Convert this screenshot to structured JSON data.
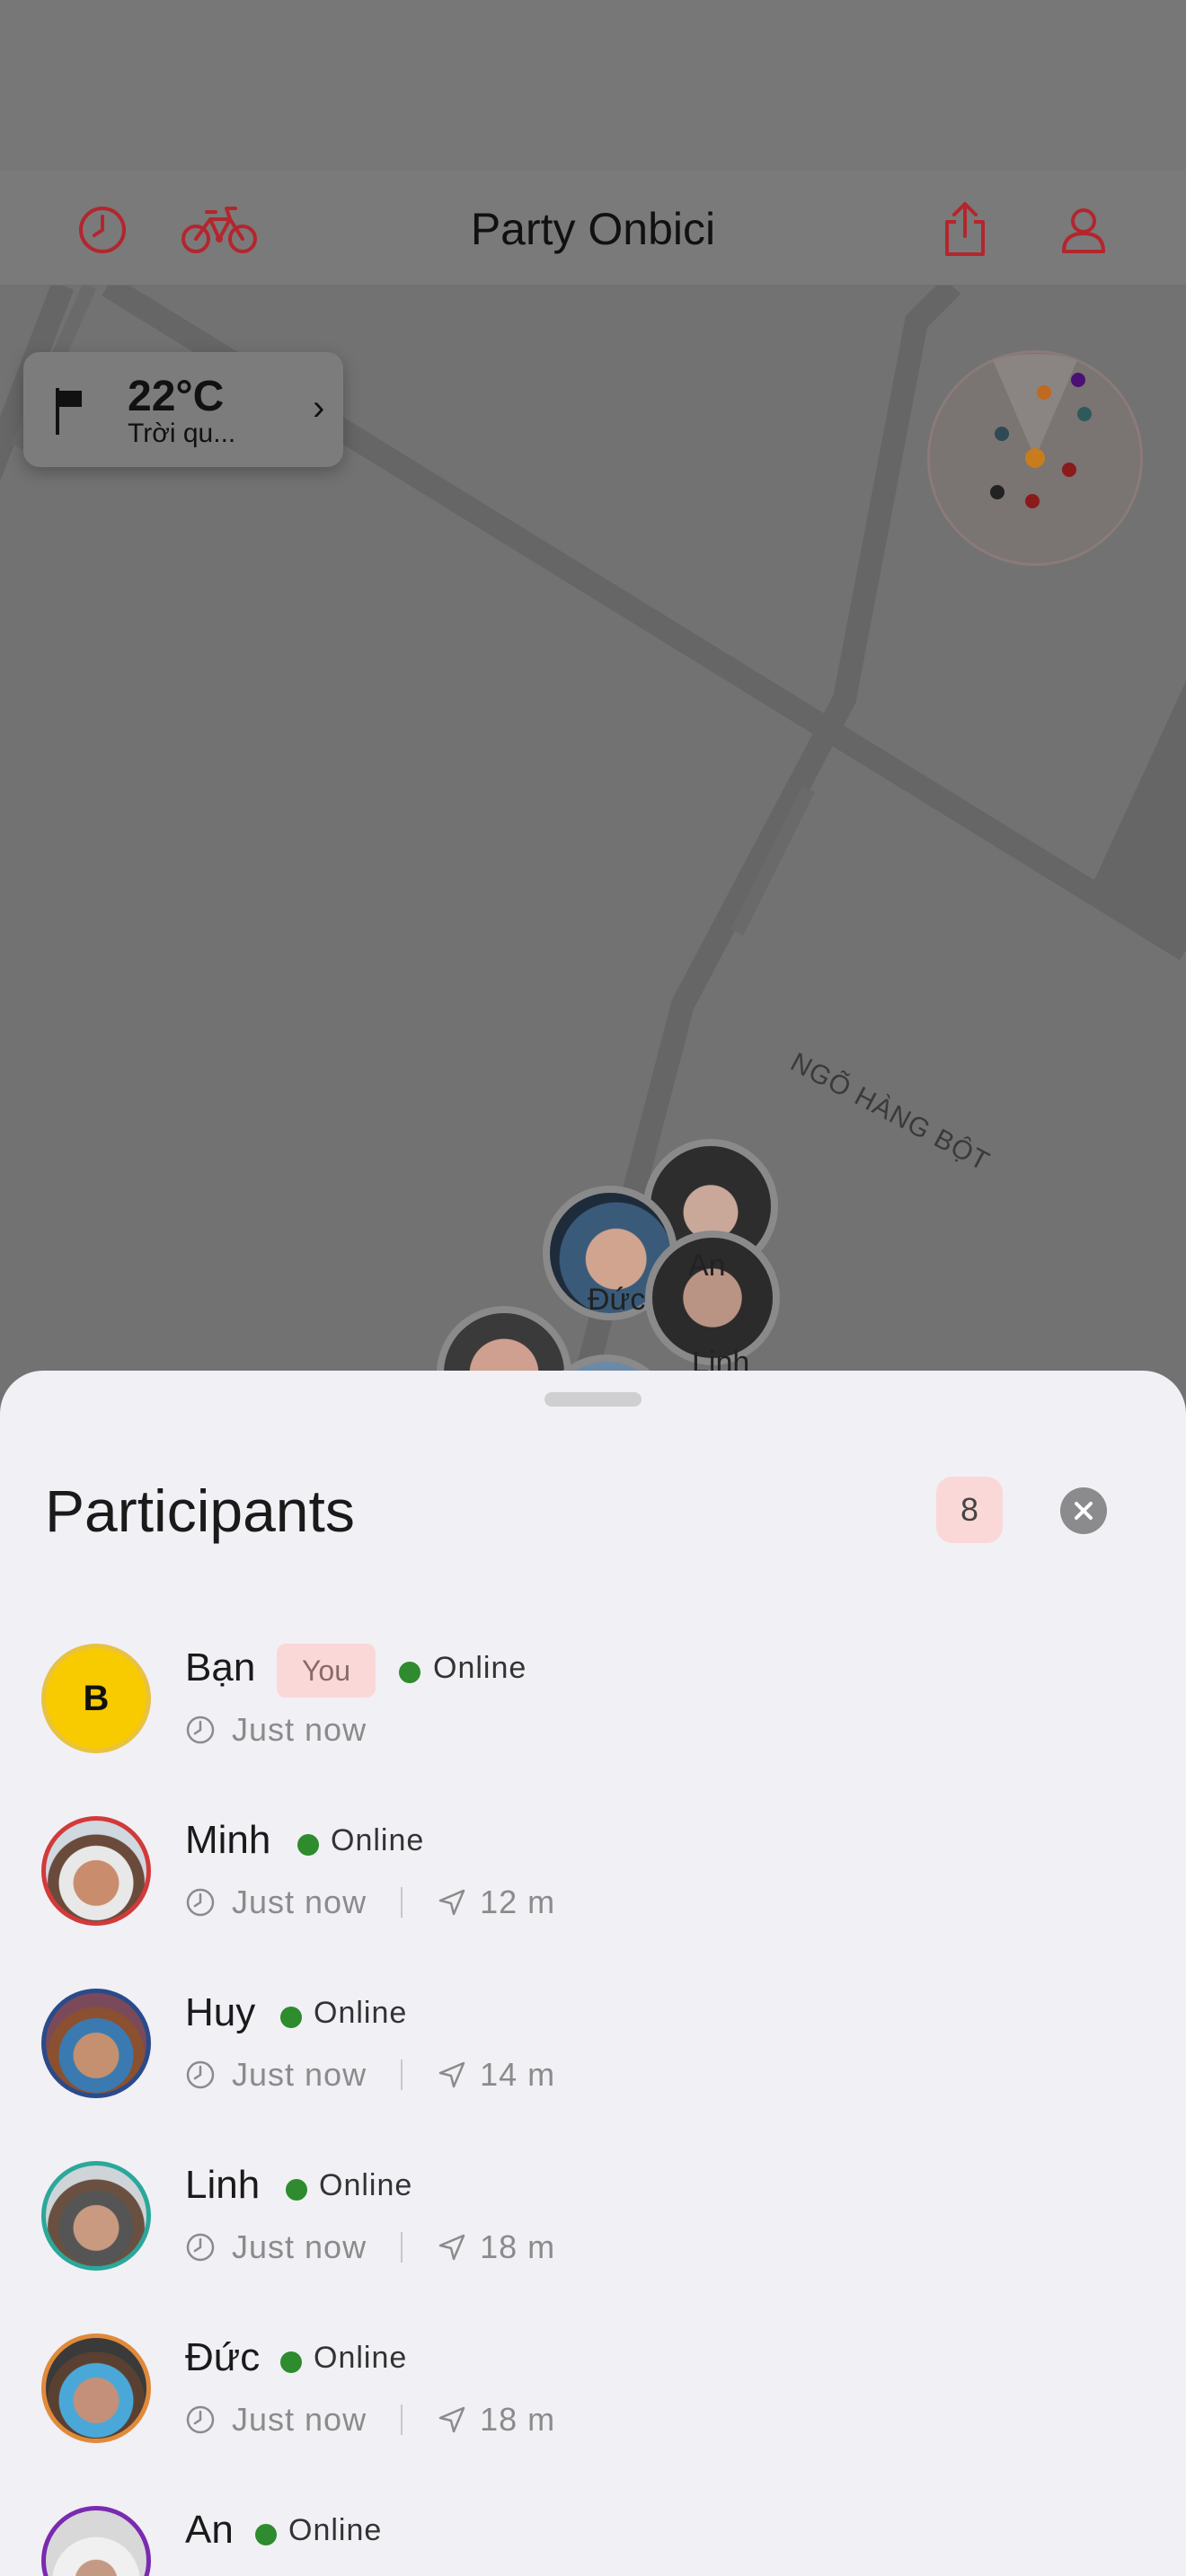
{
  "header": {
    "title": "Party Onbici",
    "icons": [
      "history-icon",
      "bicycle-icon",
      "share-icon",
      "profile-icon"
    ]
  },
  "weather": {
    "temperature": "22°C",
    "description": "Trời qu..."
  },
  "map": {
    "street_name": "NGÕ HÀNG BỘT",
    "pin_labels": [
      "Đức",
      "An",
      "Linh"
    ]
  },
  "sheet": {
    "title": "Participants",
    "count": "8",
    "online_label": "Online",
    "participants": [
      {
        "name": "Bạn",
        "initial": "B",
        "tag": "You",
        "status": "Online",
        "time": "Just now",
        "distance": ""
      },
      {
        "name": "Minh",
        "status": "Online",
        "time": "Just now",
        "distance": "12 m"
      },
      {
        "name": "Huy",
        "status": "Online",
        "time": "Just now",
        "distance": "14 m"
      },
      {
        "name": "Linh",
        "status": "Online",
        "time": "Just now",
        "distance": "18 m"
      },
      {
        "name": "Đức",
        "status": "Online",
        "time": "Just now",
        "distance": "18 m"
      },
      {
        "name": "An",
        "status": "Online",
        "time": "",
        "distance": ""
      }
    ]
  },
  "colors": {
    "accent_red": "#b3262d",
    "online_green": "#2e8b2e",
    "you_avatar": "#f7cb00",
    "badge_bg": "#fbd8d8"
  }
}
